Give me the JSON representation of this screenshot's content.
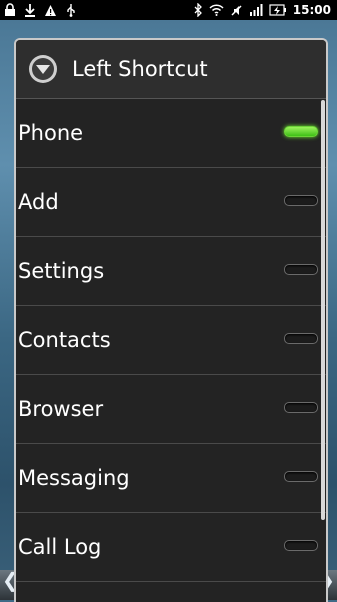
{
  "status_bar": {
    "time": "15:00",
    "left_icons": [
      "lock-icon",
      "download-icon",
      "warning-icon",
      "usb-icon"
    ],
    "right_icons": [
      "bluetooth-icon",
      "wifi-icon",
      "silent-icon",
      "signal-icon",
      "battery-charging-icon"
    ]
  },
  "dialog": {
    "title": "Left Shortcut",
    "icon": "chevron-down-circle-icon",
    "accent_color": "#55d829",
    "items": [
      {
        "label": "Phone",
        "selected": true
      },
      {
        "label": "Add",
        "selected": false
      },
      {
        "label": "Settings",
        "selected": false
      },
      {
        "label": "Contacts",
        "selected": false
      },
      {
        "label": "Browser",
        "selected": false
      },
      {
        "label": "Messaging",
        "selected": false
      },
      {
        "label": "Call Log",
        "selected": false
      }
    ]
  }
}
